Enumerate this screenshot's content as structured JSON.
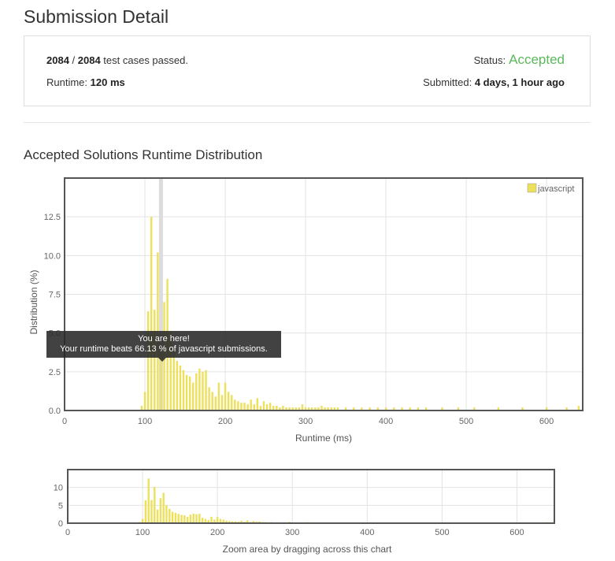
{
  "header": {
    "title": "Submission Detail"
  },
  "summary": {
    "passed": "2084",
    "sep": " / ",
    "total": "2084",
    "passed_suffix": " test cases passed.",
    "runtime_label": "Runtime: ",
    "runtime_value": "120 ms",
    "status_label": "Status:",
    "status_value": "Accepted",
    "submitted_label": "Submitted: ",
    "submitted_value": "4 days, 1 hour ago",
    "accent": "#5cb85c"
  },
  "distribution": {
    "title": "Accepted Solutions Runtime Distribution"
  },
  "tooltip": {
    "line1": "You are here!",
    "line2": "Your runtime beats 66.13 % of javascript submissions."
  },
  "zoom_caption": "Zoom area by dragging across this chart",
  "chart_data": [
    {
      "type": "bar",
      "xlabel": "Runtime (ms)",
      "ylabel": "Distribution (%)",
      "xlim": [
        0,
        645
      ],
      "ylim": [
        0,
        15
      ],
      "xticks": [
        "0",
        "100",
        "200",
        "300",
        "400",
        "500",
        "600"
      ],
      "yticks": [
        "0.0",
        "2.5",
        "5.0",
        "7.5",
        "10.0",
        "12.5"
      ],
      "legend": "javascript",
      "legend_position": "top-right",
      "bar_color": "#ede05b",
      "highlight_x": 120,
      "series": [
        {
          "name": "javascript",
          "x": [
            96,
            100,
            104,
            108,
            112,
            116,
            120,
            124,
            128,
            132,
            136,
            140,
            144,
            148,
            152,
            156,
            160,
            164,
            168,
            172,
            176,
            180,
            184,
            188,
            192,
            196,
            200,
            204,
            208,
            212,
            216,
            220,
            224,
            228,
            232,
            236,
            240,
            244,
            248,
            252,
            256,
            260,
            264,
            268,
            272,
            276,
            280,
            284,
            288,
            292,
            296,
            300,
            304,
            308,
            312,
            316,
            320,
            324,
            328,
            332,
            336,
            340,
            350,
            360,
            370,
            380,
            390,
            400,
            410,
            420,
            430,
            440,
            450,
            470,
            490,
            510,
            540,
            570,
            600,
            625,
            640
          ],
          "values": [
            0.3,
            1.2,
            6.4,
            12.5,
            6.5,
            10.2,
            3.8,
            7.0,
            8.5,
            5.1,
            4.0,
            3.2,
            2.9,
            2.6,
            2.3,
            2.2,
            1.8,
            2.4,
            2.7,
            2.5,
            2.6,
            1.5,
            1.2,
            0.9,
            1.8,
            1.0,
            1.8,
            1.2,
            1.0,
            0.7,
            0.6,
            0.5,
            0.5,
            0.4,
            0.7,
            0.4,
            0.8,
            0.3,
            0.6,
            0.4,
            0.5,
            0.3,
            0.3,
            0.2,
            0.3,
            0.2,
            0.2,
            0.2,
            0.2,
            0.2,
            0.4,
            0.2,
            0.2,
            0.2,
            0.2,
            0.2,
            0.3,
            0.2,
            0.2,
            0.2,
            0.2,
            0.2,
            0.2,
            0.2,
            0.2,
            0.2,
            0.2,
            0.2,
            0.2,
            0.2,
            0.2,
            0.2,
            0.2,
            0.2,
            0.2,
            0.2,
            0.2,
            0.2,
            0.2,
            0.2,
            0.3
          ]
        }
      ]
    },
    {
      "type": "bar",
      "xlabel": "",
      "ylabel": "",
      "xlim": [
        0,
        650
      ],
      "ylim": [
        0,
        15
      ],
      "xticks": [
        "0",
        "100",
        "200",
        "300",
        "400",
        "500",
        "600"
      ],
      "yticks": [
        "0",
        "5",
        "10"
      ],
      "bar_color": "#ede05b"
    }
  ]
}
